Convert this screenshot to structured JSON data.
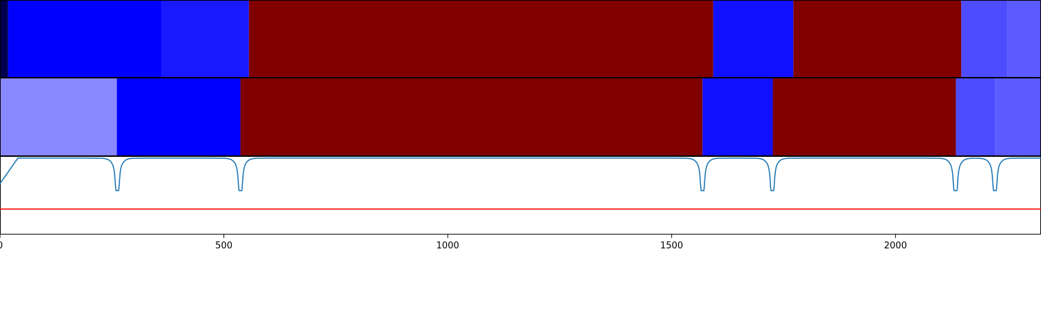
{
  "chart_data": {
    "type": "heatmap",
    "title": "",
    "xlabel": "",
    "ylabel": "",
    "xlim": [
      0,
      2325
    ],
    "xticks": [
      0,
      500,
      1000,
      1500,
      2000
    ],
    "xtick_labels": [
      "0",
      "500",
      "1000",
      "1500",
      "2000"
    ],
    "tracks": [
      {
        "segments": [
          {
            "start": 0,
            "end": 18,
            "color": "#00004d"
          },
          {
            "start": 18,
            "end": 361,
            "color": "#0000ff"
          },
          {
            "start": 361,
            "end": 556,
            "color": "#1919ff"
          },
          {
            "start": 556,
            "end": 1593,
            "color": "#800000"
          },
          {
            "start": 1593,
            "end": 1772,
            "color": "#1111ff"
          },
          {
            "start": 1772,
            "end": 2147,
            "color": "#800000"
          },
          {
            "start": 2147,
            "end": 2250,
            "color": "#4d4dff"
          },
          {
            "start": 2250,
            "end": 2325,
            "color": "#5b5bff"
          }
        ]
      },
      {
        "segments": [
          {
            "start": 0,
            "end": 261,
            "color": "#8888ff"
          },
          {
            "start": 261,
            "end": 537,
            "color": "#0000ff"
          },
          {
            "start": 537,
            "end": 1569,
            "color": "#800000"
          },
          {
            "start": 1569,
            "end": 1726,
            "color": "#1111ff"
          },
          {
            "start": 1726,
            "end": 2135,
            "color": "#800000"
          },
          {
            "start": 2135,
            "end": 2223,
            "color": "#4d4dff"
          },
          {
            "start": 2223,
            "end": 2325,
            "color": "#5b5bff"
          }
        ]
      }
    ],
    "line_series": {
      "color": "#1f77b4",
      "baseline": 1.0,
      "dips": [
        {
          "x": 262,
          "depth": 0.92
        },
        {
          "x": 537,
          "depth": 0.95
        },
        {
          "x": 1569,
          "depth": 0.93
        },
        {
          "x": 1725,
          "depth": 0.92
        },
        {
          "x": 2134,
          "depth": 0.99
        },
        {
          "x": 2222,
          "depth": 0.94
        }
      ],
      "start_value": 0.6
    },
    "threshold": {
      "value": 0.2,
      "color": "#ff0000"
    },
    "line_ylim": [
      -0.2,
      1.02
    ]
  }
}
